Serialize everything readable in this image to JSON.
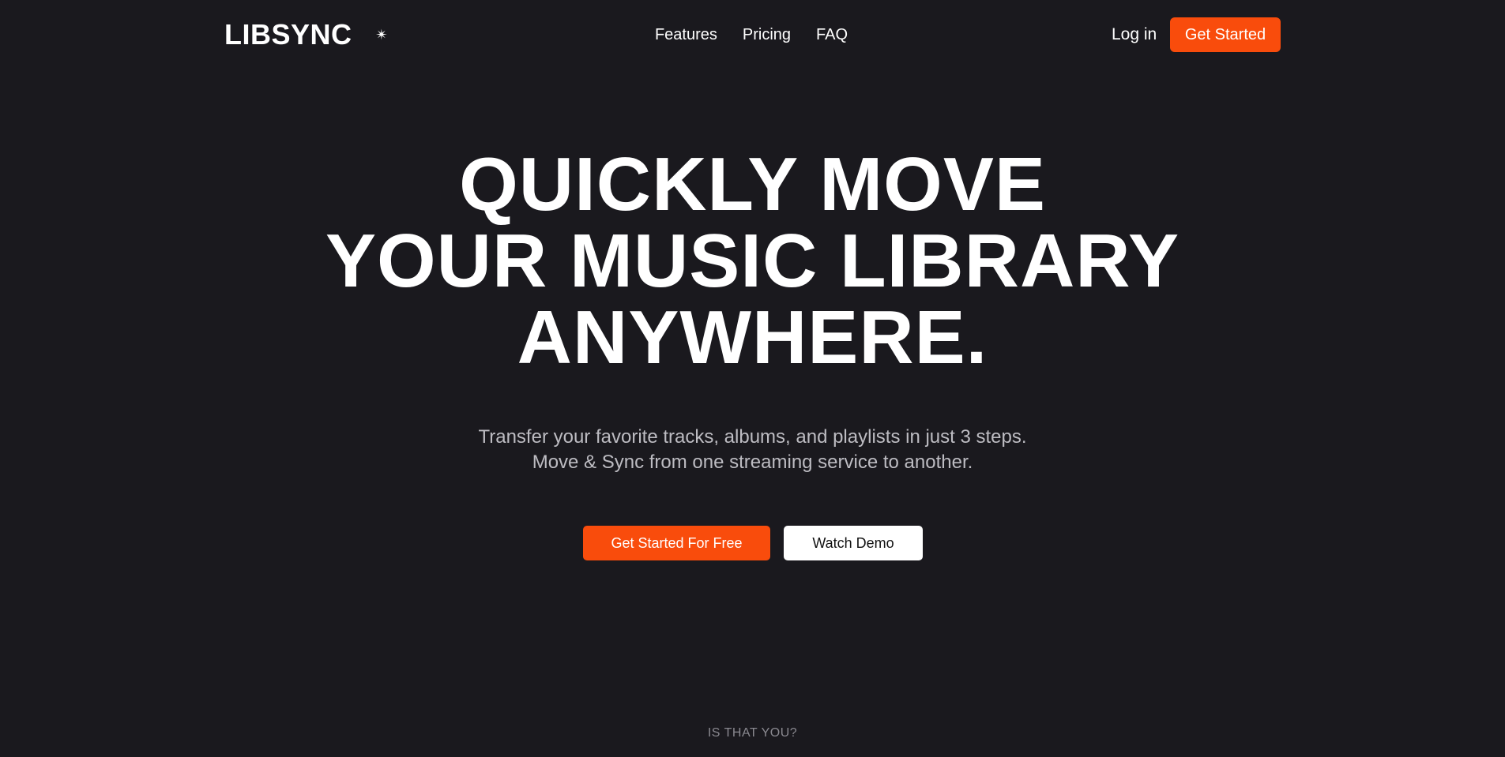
{
  "brand": {
    "name": "LIBSYNC",
    "sparkle_glyph": "✴",
    "accent_color": "#f94c0c",
    "background_color": "#1a191e"
  },
  "nav": {
    "links": [
      "Features",
      "Pricing",
      "FAQ"
    ],
    "login_label": "Log in",
    "cta_label": "Get Started"
  },
  "hero": {
    "title_lines": [
      "QUICKLY MOVE",
      "YOUR MUSIC LIBRARY",
      "ANYWHERE."
    ],
    "subtitle_lines": [
      "Transfer your favorite tracks, albums, and playlists in just 3 steps.",
      "Move & Sync from one streaming service to another."
    ],
    "primary_cta": "Get Started For Free",
    "secondary_cta": "Watch Demo"
  },
  "next_section": {
    "eyebrow": "IS THAT YOU?"
  }
}
